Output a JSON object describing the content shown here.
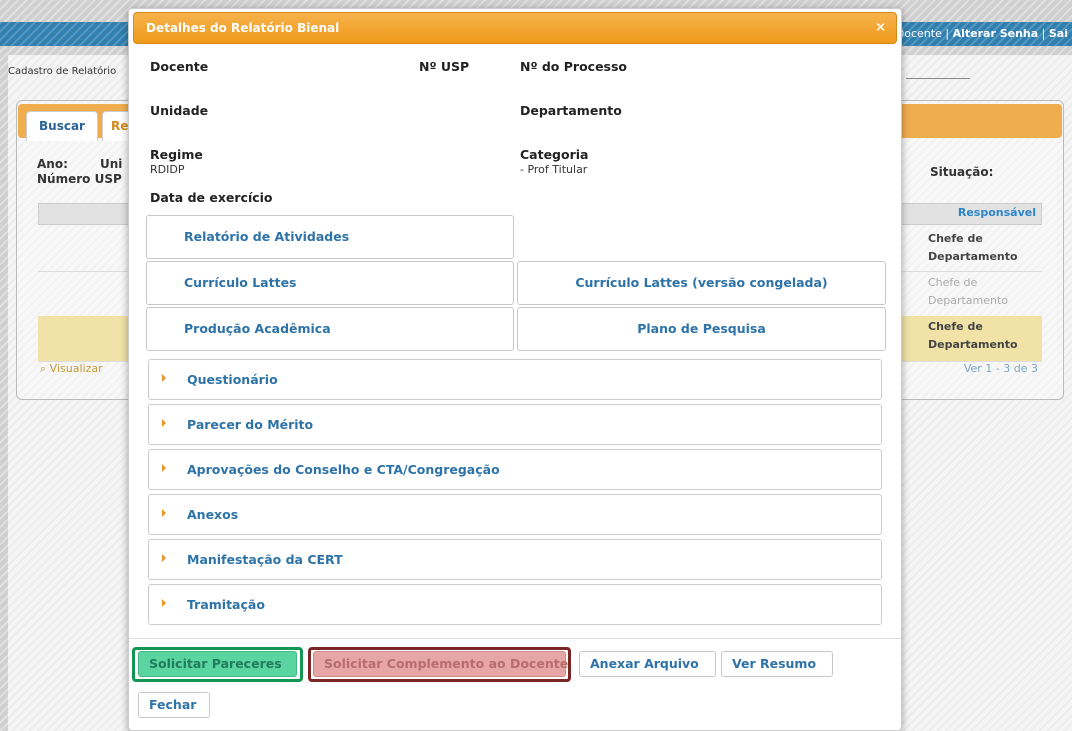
{
  "background": {
    "header_links": [
      "Docente",
      "Alterar Senha",
      "Sai"
    ],
    "breadcrumb": "Cadastro de Relatório",
    "tabs": [
      "Buscar",
      "Re"
    ],
    "fields": {
      "ano": "Ano:",
      "uni": "Uni",
      "numero_usp": "Número USP",
      "situacao": "Situação:"
    },
    "grid": {
      "responsavel_header": "Responsável",
      "rows": [
        {
          "responsavel": "Chefe de Departamento"
        },
        {
          "responsavel": "Chefe de Departamento"
        },
        {
          "responsavel": "Chefe de Departamento"
        }
      ],
      "visualizar": "Visualizar",
      "pager": "Ver 1 - 3 de 3"
    }
  },
  "modal": {
    "title": "Detalhes do Relatório Bienal",
    "close_glyph": "×",
    "labels": {
      "docente": "Docente",
      "nusp": "Nº USP",
      "nprocesso": "Nº do Processo",
      "unidade": "Unidade",
      "departamento": "Departamento",
      "regime": "Regime",
      "categoria": "Categoria",
      "data_exercicio": "Data de exercício"
    },
    "values": {
      "regime": "RDIDP",
      "categoria": "- Prof Titular"
    },
    "link_buttons": {
      "relatorio_atividades": "Relatório de Atividades",
      "curriculo_lattes": "Currículo Lattes",
      "curriculo_lattes_congelada": "Currículo Lattes (versão congelada)",
      "producao_academica": "Produção Acadêmica",
      "plano_pesquisa": "Plano de Pesquisa"
    },
    "accordion": [
      "Questionário",
      "Parecer do Mérito",
      "Aprovações do Conselho e CTA/Congregação",
      "Anexos",
      "Manifestação da CERT",
      "Tramitação"
    ],
    "buttons": {
      "solicitar_pareceres": "Solicitar Pareceres",
      "solicitar_complemento": "Solicitar Complemento ao Docente",
      "anexar_arquivo": "Anexar Arquivo",
      "ver_resumo": "Ver Resumo",
      "fechar": "Fechar"
    },
    "highlight_colors": {
      "green": "#129651",
      "red": "#7b2524"
    }
  }
}
